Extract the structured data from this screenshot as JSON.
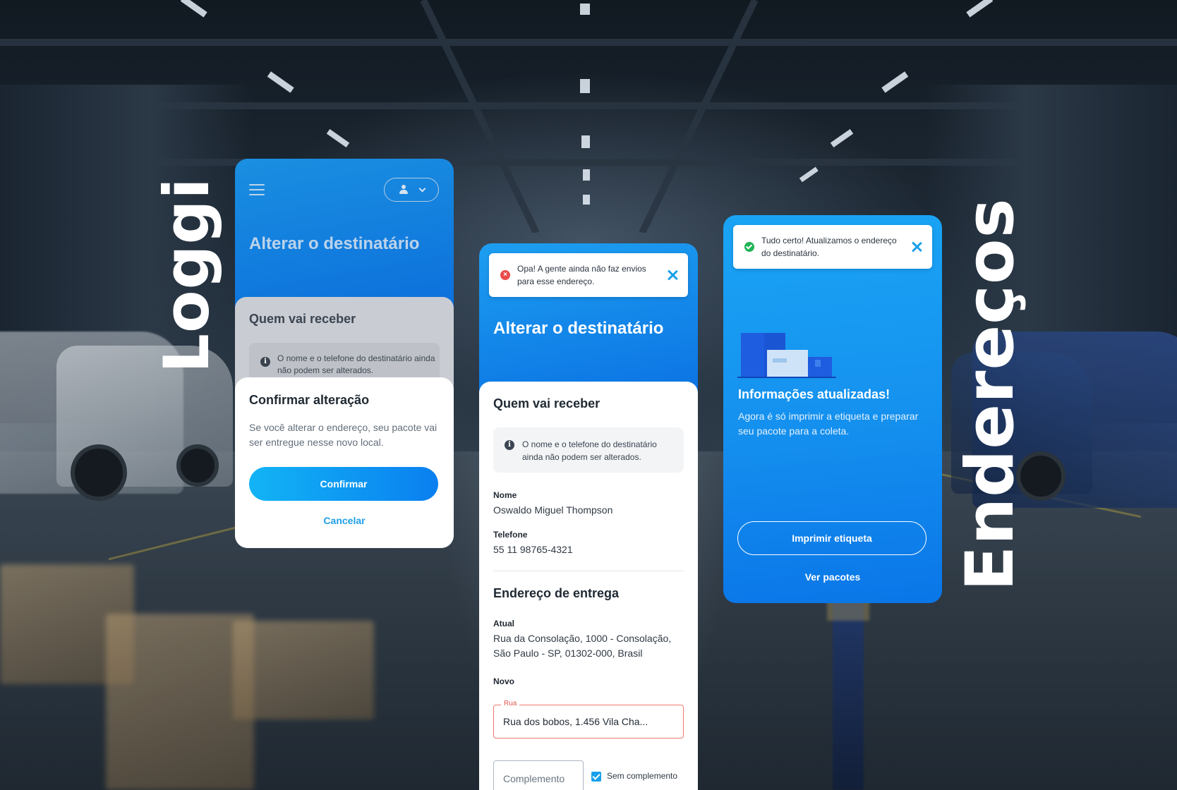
{
  "brand": "Loggi",
  "section_title": "Endereços",
  "colors": {
    "primary_blue": "#0b73e6",
    "accent_cyan": "#1aa0ea",
    "error_red": "#ea4b4b",
    "success_green": "#20b455"
  },
  "screen_confirm": {
    "menu_icon": "hamburger-icon",
    "user_icon": "user-icon",
    "title": "Alterar o destinatário",
    "section": "Quem vai receber",
    "info_text": "O nome e o telefone do destinatário ainda não podem ser alterados.",
    "dialog": {
      "title": "Confirmar alteração",
      "text": "Se você alterar o endereço, seu pacote vai ser entregue nesse novo local.",
      "confirm_label": "Confirmar",
      "cancel_label": "Cancelar"
    }
  },
  "screen_form": {
    "toast_error": "Opa! A gente ainda não faz envios para esse endereço.",
    "title": "Alterar o destinatário",
    "section_recipient": "Quem vai receber",
    "info_text": "O nome e o telefone do destinatário ainda não podem ser alterados.",
    "name_label": "Nome",
    "name_value": "Oswaldo Miguel Thompson",
    "phone_label": "Telefone",
    "phone_value": "55 11 98765-4321",
    "section_address": "Endereço de entrega",
    "current_label": "Atual",
    "current_value": "Rua da Consolação, 1000 - Consolação, São Paulo - SP, 01302-000, Brasil",
    "new_label": "Novo",
    "street_label": "Rua",
    "street_value": "Rua dos bobos, 1.456 Vila Cha...",
    "complement_placeholder": "Complemento",
    "no_complement_label": "Sem complemento",
    "no_complement_checked": true
  },
  "screen_success": {
    "toast_success": "Tudo certo! Atualizamos o endereço do destinatário.",
    "heading": "Informações atualizadas!",
    "text": "Agora é só imprimir a etiqueta e preparar seu pacote para a coleta.",
    "print_label": "Imprimir etiqueta",
    "packages_label": "Ver pacotes"
  }
}
